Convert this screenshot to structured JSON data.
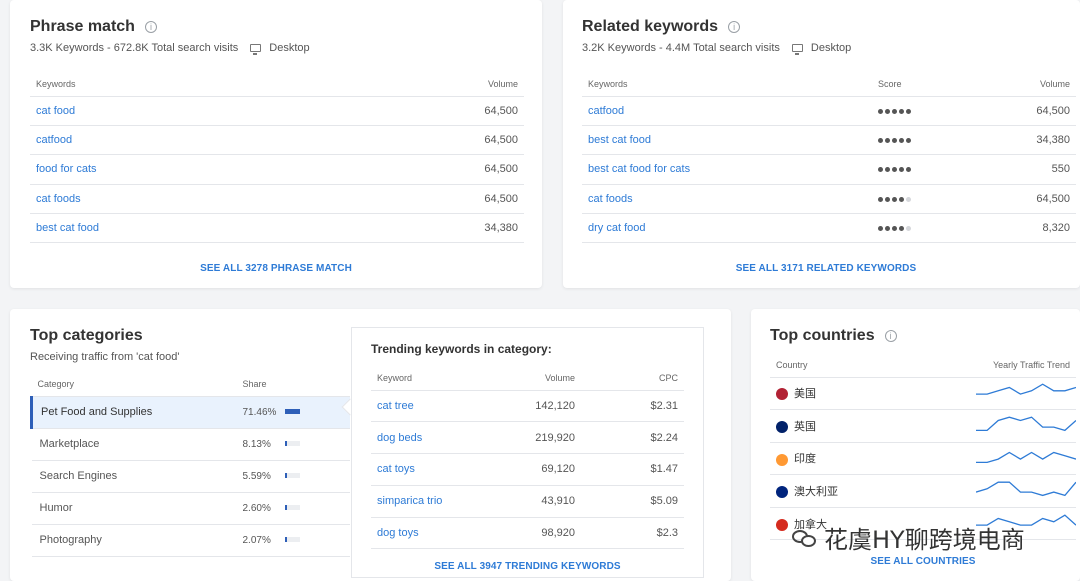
{
  "phrase_match": {
    "title": "Phrase match",
    "subtitle": "3.3K Keywords - 672.8K Total search visits",
    "device": "Desktop",
    "col_keywords": "Keywords",
    "col_volume": "Volume",
    "rows": [
      {
        "keyword": "cat food",
        "volume": "64,500"
      },
      {
        "keyword": "catfood",
        "volume": "64,500"
      },
      {
        "keyword": "food for cats",
        "volume": "64,500"
      },
      {
        "keyword": "cat foods",
        "volume": "64,500"
      },
      {
        "keyword": "best cat food",
        "volume": "34,380"
      }
    ],
    "see_all": "SEE ALL 3278 PHRASE MATCH"
  },
  "related_keywords": {
    "title": "Related keywords",
    "subtitle": "3.2K Keywords - 4.4M Total search visits",
    "device": "Desktop",
    "col_keywords": "Keywords",
    "col_score": "Score",
    "col_volume": "Volume",
    "rows": [
      {
        "keyword": "catfood",
        "score": 5,
        "volume": "64,500"
      },
      {
        "keyword": "best cat food",
        "score": 5,
        "volume": "34,380"
      },
      {
        "keyword": "best cat food for cats",
        "score": 5,
        "volume": "550"
      },
      {
        "keyword": "cat foods",
        "score": 4,
        "volume": "64,500"
      },
      {
        "keyword": "dry cat food",
        "score": 4,
        "volume": "8,320"
      }
    ],
    "see_all": "SEE ALL 3171 RELATED KEYWORDS"
  },
  "top_categories": {
    "title": "Top categories",
    "subtitle": "Receiving traffic from 'cat food'",
    "col_category": "Category",
    "col_share": "Share",
    "rows": [
      {
        "category": "Pet Food and Supplies",
        "share": "71.46%",
        "share_value": 0.7146
      },
      {
        "category": "Marketplace",
        "share": "8.13%",
        "share_value": 0.0813
      },
      {
        "category": "Search Engines",
        "share": "5.59%",
        "share_value": 0.0559
      },
      {
        "category": "Humor",
        "share": "2.60%",
        "share_value": 0.026
      },
      {
        "category": "Photography",
        "share": "2.07%",
        "share_value": 0.0207
      }
    ]
  },
  "trending": {
    "title": "Trending keywords in category:",
    "col_keyword": "Keyword",
    "col_volume": "Volume",
    "col_cpc": "CPC",
    "rows": [
      {
        "keyword": "cat tree",
        "volume": "142,120",
        "cpc": "$2.31"
      },
      {
        "keyword": "dog beds",
        "volume": "219,920",
        "cpc": "$2.24"
      },
      {
        "keyword": "cat toys",
        "volume": "69,120",
        "cpc": "$1.47"
      },
      {
        "keyword": "simparica trio",
        "volume": "43,910",
        "cpc": "$5.09"
      },
      {
        "keyword": "dog toys",
        "volume": "98,920",
        "cpc": "$2.3"
      }
    ],
    "see_all": "SEE ALL 3947 TRENDING KEYWORDS"
  },
  "top_countries": {
    "title": "Top countries",
    "col_country": "Country",
    "col_trend": "Yearly Traffic Trend",
    "rows": [
      {
        "country": "美国",
        "flag_color": "#b22234",
        "trend": [
          3,
          3,
          4,
          5,
          3,
          4,
          6,
          4,
          4,
          5
        ]
      },
      {
        "country": "英国",
        "flag_color": "#012169",
        "trend": [
          2,
          2,
          5,
          6,
          5,
          6,
          3,
          3,
          2,
          5
        ]
      },
      {
        "country": "印度",
        "flag_color": "#ff9933",
        "trend": [
          2,
          2,
          3,
          5,
          3,
          5,
          3,
          5,
          4,
          3
        ]
      },
      {
        "country": "澳大利亚",
        "flag_color": "#00247d",
        "trend": [
          3,
          4,
          6,
          6,
          3,
          3,
          2,
          3,
          2,
          6
        ]
      },
      {
        "country": "加拿大",
        "flag_color": "#d52b1e",
        "trend": [
          3,
          3,
          5,
          4,
          3,
          3,
          5,
          4,
          6,
          3
        ]
      }
    ],
    "see_all": "SEE ALL COUNTRIES"
  },
  "watermark": "花虞HY聊跨境电商",
  "colors": {
    "accent": "#2e7bd6",
    "bar": "#2e5fb8",
    "spark": "#2e7bd6"
  }
}
